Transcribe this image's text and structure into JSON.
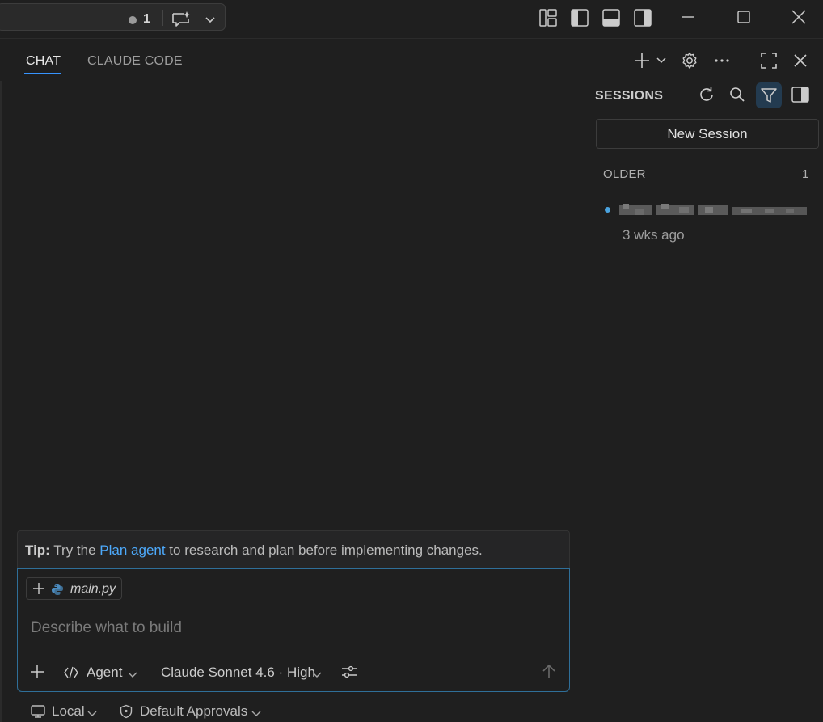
{
  "titlebar": {
    "notification_count": "1",
    "icons": [
      "dot-icon",
      "chat-sparkle-icon",
      "chevron-down-icon",
      "layout-customize-icon",
      "toggle-primary-sidebar-icon",
      "toggle-panel-icon",
      "toggle-secondary-sidebar-icon"
    ],
    "window_controls": [
      "minimize-icon",
      "maximize-icon",
      "close-icon"
    ]
  },
  "panel": {
    "tabs": [
      {
        "label": "CHAT",
        "active": true
      },
      {
        "label": "CLAUDE CODE",
        "active": false
      }
    ],
    "actions": [
      "new-chat-icon",
      "chevron-down-icon",
      "gear-icon",
      "more-icon",
      "maximize-panel-icon",
      "close-icon"
    ]
  },
  "sessions": {
    "title": "SESSIONS",
    "actions": [
      "refresh-icon",
      "search-icon",
      "filter-icon",
      "toggle-sidebar-icon"
    ],
    "new_session_label": "New Session",
    "group_label": "OLDER",
    "group_count": "1",
    "items": [
      {
        "time": "3 wks ago"
      }
    ]
  },
  "tip": {
    "bold": "Tip:",
    "pre": " Try the ",
    "link": "Plan agent",
    "post": " to research and plan before implementing changes."
  },
  "input": {
    "context_file": "main.py",
    "placeholder": "Describe what to build",
    "mode_label": "Agent",
    "model_label": "Claude Sonnet 4.6 · High"
  },
  "footer": {
    "location_label": "Local",
    "approvals_label": "Default Approvals"
  },
  "colors": {
    "background": "#1f1f1f",
    "accent": "#3794ff",
    "link": "#4daafc",
    "input_border": "#2f6f99",
    "session_dot": "#4aa3df",
    "filter_active_bg": "#233b50"
  }
}
